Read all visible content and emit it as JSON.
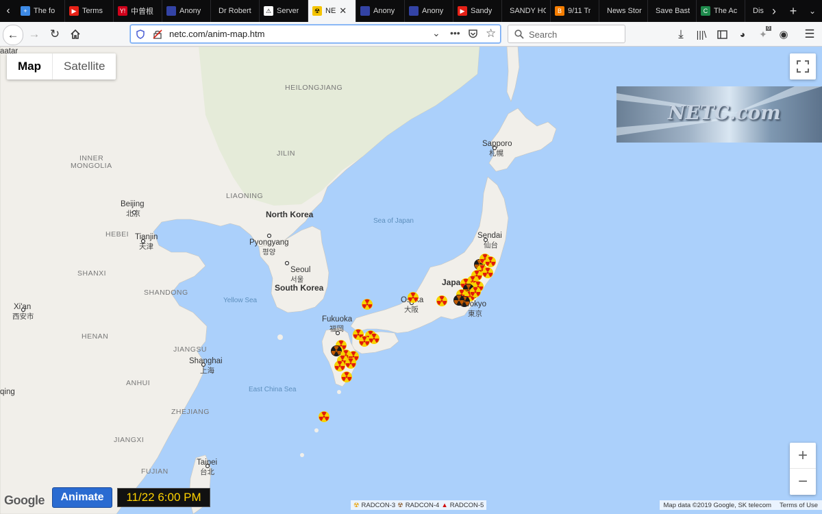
{
  "tabs": [
    {
      "label": "The fo",
      "fav_color": "#3d8ae6",
      "fav_glyph": "+"
    },
    {
      "label": "Terms",
      "fav_color": "#e62117",
      "fav_glyph": "▶"
    },
    {
      "label": "中曾根",
      "fav_color": "#d0021b",
      "fav_glyph": "Y!"
    },
    {
      "label": "Anony",
      "fav_color": "#3343a5",
      "fav_glyph": ""
    },
    {
      "label": "Dr Robert",
      "fav_color": "",
      "fav_glyph": ""
    },
    {
      "label": "Server",
      "fav_color": "#ffffff",
      "fav_glyph": "⚠"
    },
    {
      "label": "NE",
      "fav_color": "#f5c400",
      "fav_glyph": "☢",
      "active": true
    },
    {
      "label": "Anony",
      "fav_color": "#3343a5",
      "fav_glyph": ""
    },
    {
      "label": "Anony",
      "fav_color": "#3343a5",
      "fav_glyph": ""
    },
    {
      "label": "Sandy",
      "fav_color": "#e62117",
      "fav_glyph": "▶"
    },
    {
      "label": "SANDY HO",
      "fav_color": "",
      "fav_glyph": ""
    },
    {
      "label": "9/11 Tr",
      "fav_color": "#f57d00",
      "fav_glyph": "B"
    },
    {
      "label": "News Stor",
      "fav_color": "",
      "fav_glyph": ""
    },
    {
      "label": "Save Bast",
      "fav_color": "",
      "fav_glyph": ""
    },
    {
      "label": "The Ac",
      "fav_color": "#1e8a4c",
      "fav_glyph": "C"
    },
    {
      "label": "Dis",
      "fav_color": "",
      "fav_glyph": ""
    }
  ],
  "nav": {
    "url": "netc.com/anim-map.htm",
    "search_placeholder": "Search"
  },
  "map": {
    "map_button": "Map",
    "satellite_button": "Satellite",
    "logo_text": "NETC.com",
    "animate_label": "Animate",
    "time_display": "11/22 6:00 PM",
    "attribution": "Map data ©2019 Google, SK telecom",
    "terms": "Terms of Use",
    "google": "Google",
    "legend": [
      {
        "label": "RADCON-3",
        "color": "#e8a000"
      },
      {
        "label": "RADCON-4",
        "color": "#8a5a2b"
      },
      {
        "label": "RADCON-5",
        "color": "#d01010"
      }
    ],
    "labels": {
      "heilongjiang": "HEILONGJIANG",
      "jilin": "JILIN",
      "liaoning": "LIAONING",
      "inner_mongolia_1": "INNER",
      "inner_mongolia_2": "MONGOLIA",
      "hebei": "HEBEI",
      "shanxi": "SHANXI",
      "shandong": "SHANDONG",
      "henan": "HENAN",
      "jiangsu": "JIANGSU",
      "anhui": "ANHUI",
      "zhejiang": "ZHEJIANG",
      "jiangxi": "JIANGXI",
      "fujian": "FUJIAN",
      "beijing": "Beijing",
      "beijing_cjk": "北京",
      "tianjin": "Tianjin",
      "tianjin_cjk": "天津",
      "xian": "Xi'an",
      "xian_cjk": "西安市",
      "shanghai": "Shanghai",
      "shanghai_cjk": "上海",
      "taipei": "Taipei",
      "taipei_cjk": "台北",
      "ulaanbaatar": "aatar",
      "qing": "qing",
      "north_korea": "North Korea",
      "south_korea": "South Korea",
      "pyongyang": "Pyongyang",
      "pyongyang_cjk": "평양",
      "seoul": "Seoul",
      "seoul_cjk": "서울",
      "japan": "Japan",
      "sapporo": "Sapporo",
      "sapporo_cjk": "札幌",
      "sendai": "Sendai",
      "sendai_cjk": "仙台",
      "tokyo": "Tokyo",
      "tokyo_cjk": "東京",
      "osaka": "Osaka",
      "osaka_cjk": "大阪",
      "fukuoka": "Fukuoka",
      "fukuoka_cjk": "福岡",
      "sea_of_japan": "Sea of Japan",
      "yellow_sea": "Yellow Sea",
      "east_china_sea": "East China Sea"
    },
    "colors": {
      "water": "#abd0fb",
      "land": "#f1efea",
      "land_green": "#dfe9d2",
      "radcon_yellow": "#f7d300",
      "radcon_red": "#e01b0b",
      "radcon_black": "#1a1a1a"
    }
  }
}
